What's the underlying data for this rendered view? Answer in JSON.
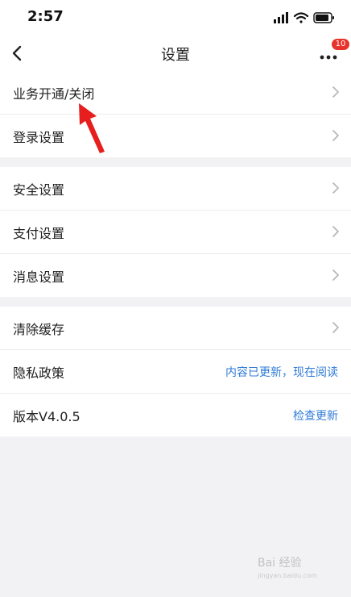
{
  "status_bar": {
    "time": "2:57"
  },
  "nav": {
    "title": "设置",
    "more_badge": "10"
  },
  "groups": [
    {
      "items": [
        {
          "label": "业务开通/关闭"
        },
        {
          "label": "登录设置"
        }
      ]
    },
    {
      "items": [
        {
          "label": "安全设置"
        },
        {
          "label": "支付设置"
        },
        {
          "label": "消息设置"
        }
      ]
    },
    {
      "items": [
        {
          "label": "清除缓存"
        },
        {
          "label": "隐私政策",
          "link": "内容已更新，现在阅读"
        },
        {
          "label": "版本V4.0.5",
          "link": "检查更新"
        }
      ]
    }
  ],
  "colors": {
    "link": "#2f7bd8",
    "badge": "#e8322c",
    "annotation_arrow": "#e61e1e"
  },
  "watermark": {
    "text": "Bai 经验",
    "sub": "jingyan.baidu.com"
  }
}
